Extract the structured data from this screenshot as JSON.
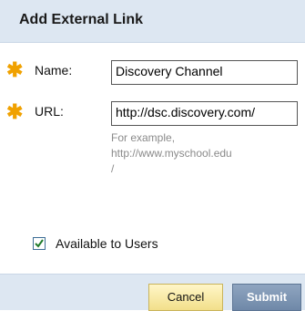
{
  "dialog": {
    "title": "Add External Link",
    "fields": {
      "name": {
        "label": "Name:",
        "value": "Discovery Channel",
        "required": true
      },
      "url": {
        "label": "URL:",
        "value": "http://dsc.discovery.com/",
        "required": true,
        "hint_lines": [
          "For example,",
          "http://www.myschool.edu",
          "/"
        ]
      }
    },
    "available_to_users": {
      "label": "Available to Users",
      "checked": true
    },
    "buttons": {
      "cancel": "Cancel",
      "submit": "Submit"
    }
  },
  "colors": {
    "header_bg": "#dde7f2",
    "required_star": "#f0a100",
    "hint_text": "#8a8a8a",
    "cancel_button": "#f2df8a",
    "submit_button": "#6f88a8"
  },
  "icons": {
    "required": "asterisk-icon",
    "checkbox": "checkmark-icon"
  }
}
